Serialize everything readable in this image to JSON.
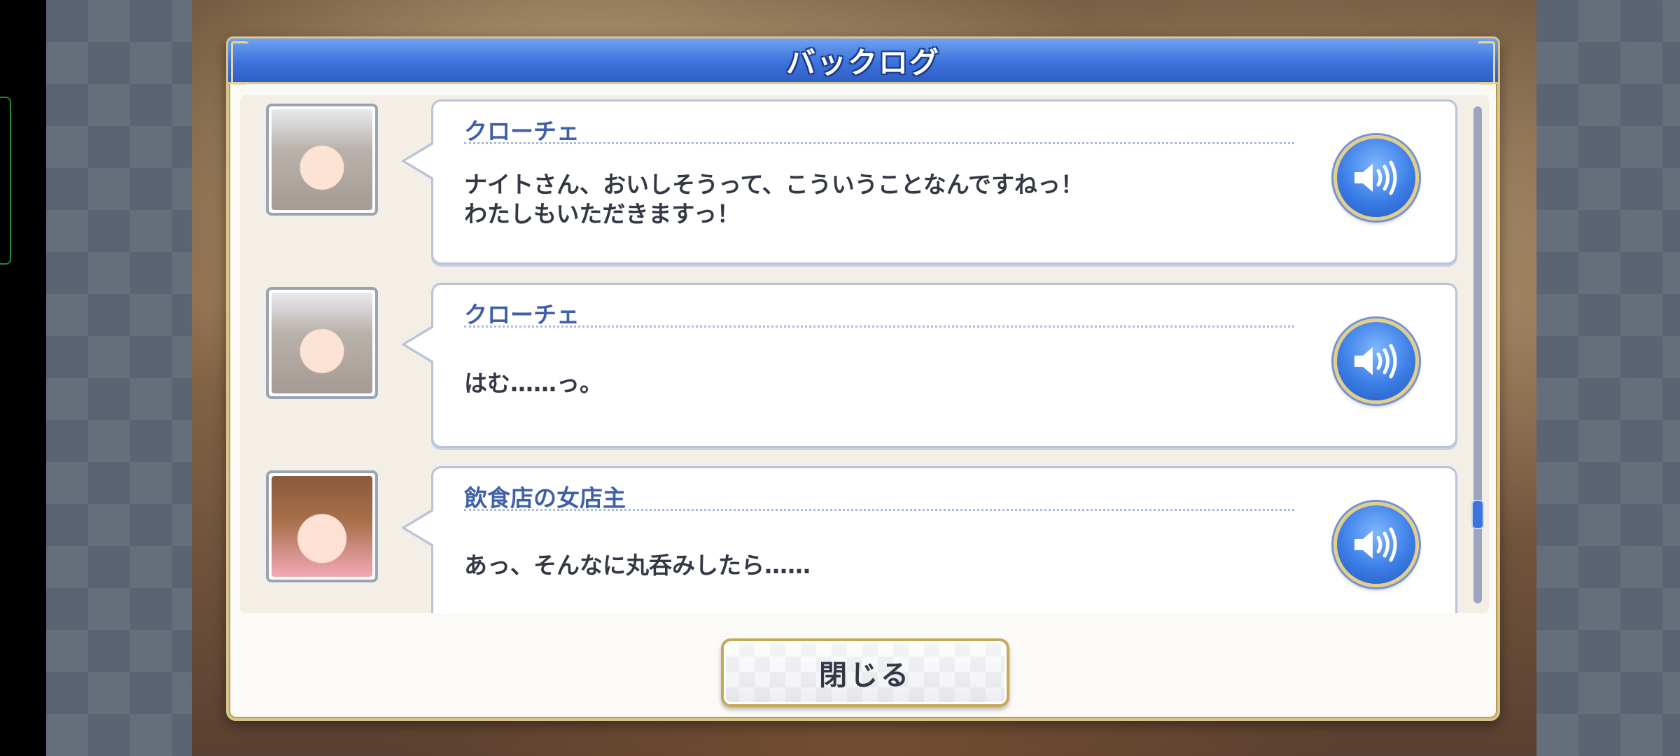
{
  "dialog": {
    "title": "バックログ",
    "close_label": "閉じる"
  },
  "entries": [
    {
      "speaker": "クローチェ",
      "lines": [
        "ナイトさん、おいしそうって、こういうことなんですねっ！",
        "わたしもいただきますっ！"
      ],
      "avatar_icon": "kloe-portrait-icon"
    },
    {
      "speaker": "クローチェ",
      "lines": [
        "はむ……っ。"
      ],
      "avatar_icon": "kloe-portrait-icon"
    },
    {
      "speaker": "飲食店の女店主",
      "lines": [
        "あっ、そんなに丸呑みしたら……"
      ],
      "avatar_icon": "shop-owner-portrait-icon"
    }
  ],
  "icons": {
    "voice": "speaker-volume-icon"
  },
  "colors": {
    "title_bar": "#3d73dc",
    "gold_border": "#d9c58c",
    "speaker_name": "#3f5fa8",
    "text": "#333844"
  }
}
